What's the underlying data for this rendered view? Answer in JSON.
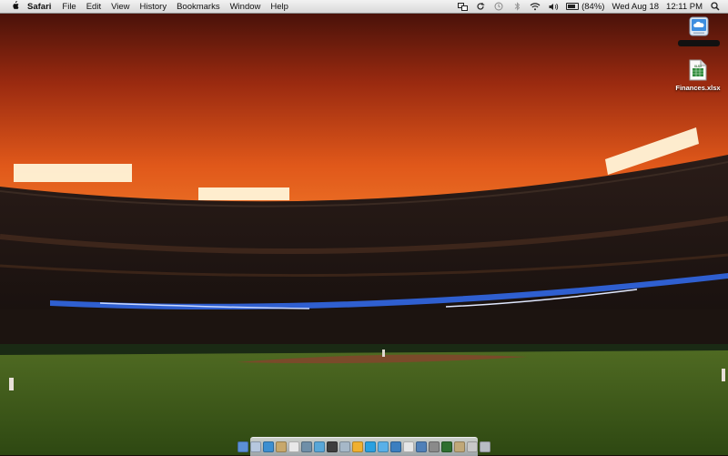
{
  "menubar": {
    "app_name": "Safari",
    "menus": [
      "File",
      "Edit",
      "View",
      "History",
      "Bookmarks",
      "Window",
      "Help"
    ],
    "status": {
      "battery_percent": "(84%)",
      "battery_level": 0.84,
      "date": "Wed Aug 18",
      "time": "12:11 PM"
    },
    "icons": [
      "apple-icon",
      "screen-mirroring-icon",
      "sync-icon",
      "time-machine-icon",
      "bluetooth-icon",
      "wifi-icon",
      "volume-icon",
      "battery-icon",
      "spotlight-icon"
    ]
  },
  "desktop": {
    "icons": [
      {
        "name": "cloud-drive-icon",
        "label": ""
      },
      {
        "name": "xlsx-file-icon",
        "label": "Finances.xlsx",
        "badge": "XLSX"
      }
    ]
  },
  "dock": {
    "apps": [
      {
        "name": "finder-app",
        "color": "#5b8fd6"
      },
      {
        "name": "mail-app",
        "color": "#b6c7de"
      },
      {
        "name": "safari-app",
        "color": "#3d8fd1"
      },
      {
        "name": "addressbook-app",
        "color": "#c8a86b"
      },
      {
        "name": "ical-app",
        "color": "#e8e8e8"
      },
      {
        "name": "iphoto-app",
        "color": "#6f8fa8"
      },
      {
        "name": "itunes-app",
        "color": "#58a7d8"
      },
      {
        "name": "photobooth-app",
        "color": "#3e3e3e"
      },
      {
        "name": "preview-app",
        "color": "#a6b8c8"
      },
      {
        "name": "adium-app",
        "color": "#f0b030"
      },
      {
        "name": "skype-app",
        "color": "#2aa0e0"
      },
      {
        "name": "ichat-app",
        "color": "#5ab0e8"
      },
      {
        "name": "spaces-app",
        "color": "#3b7fc0"
      },
      {
        "name": "textedit-app",
        "color": "#e6e6e6"
      },
      {
        "name": "xcode-app",
        "color": "#5080b8"
      },
      {
        "name": "system-preferences-app",
        "color": "#8a8a8a"
      },
      {
        "name": "activity-monitor-app",
        "color": "#2f6f2f"
      },
      {
        "name": "documents-folder",
        "color": "#c0a878"
      },
      {
        "name": "downloads-folder",
        "color": "#c8c8c8"
      },
      {
        "name": "trash-app",
        "color": "#b8bcc4"
      }
    ]
  }
}
